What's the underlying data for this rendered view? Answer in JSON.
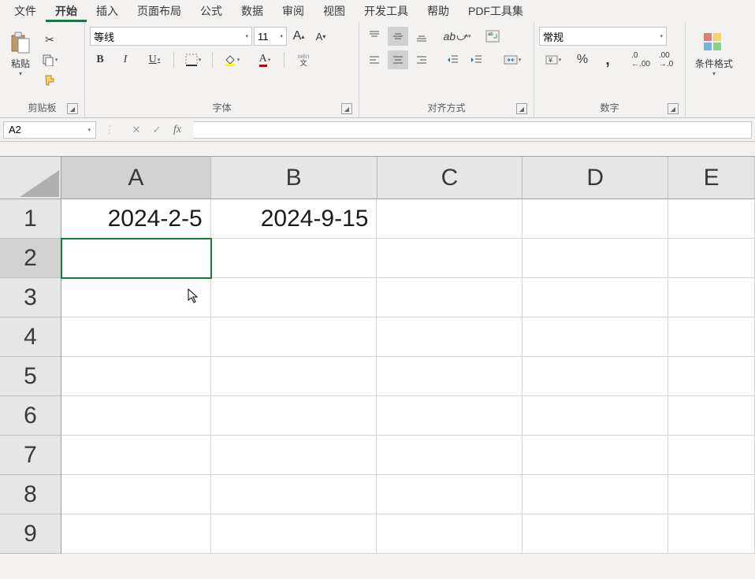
{
  "menu": {
    "items": [
      "文件",
      "开始",
      "插入",
      "页面布局",
      "公式",
      "数据",
      "审阅",
      "视图",
      "开发工具",
      "帮助",
      "PDF工具集"
    ],
    "active_index": 1
  },
  "ribbon": {
    "clipboard": {
      "label": "剪贴板",
      "paste": "粘贴"
    },
    "font": {
      "label": "字体",
      "font_name": "等线",
      "font_size": "11",
      "bold": "B",
      "italic": "I",
      "underline": "U",
      "phonetic": "wén 文"
    },
    "alignment": {
      "label": "对齐方式"
    },
    "number": {
      "label": "数字",
      "format": "常规"
    },
    "styles": {
      "cond_fmt": "条件格式"
    }
  },
  "formula_bar": {
    "name_box": "A2",
    "fx": "fx",
    "formula": ""
  },
  "grid": {
    "columns": [
      "A",
      "B",
      "C",
      "D",
      "E"
    ],
    "rows": [
      "1",
      "2",
      "3",
      "4",
      "5",
      "6",
      "7",
      "8",
      "9"
    ],
    "selected_cell": "A2",
    "cells": {
      "A1": "2024-2-5",
      "B1": "2024-9-15"
    }
  }
}
